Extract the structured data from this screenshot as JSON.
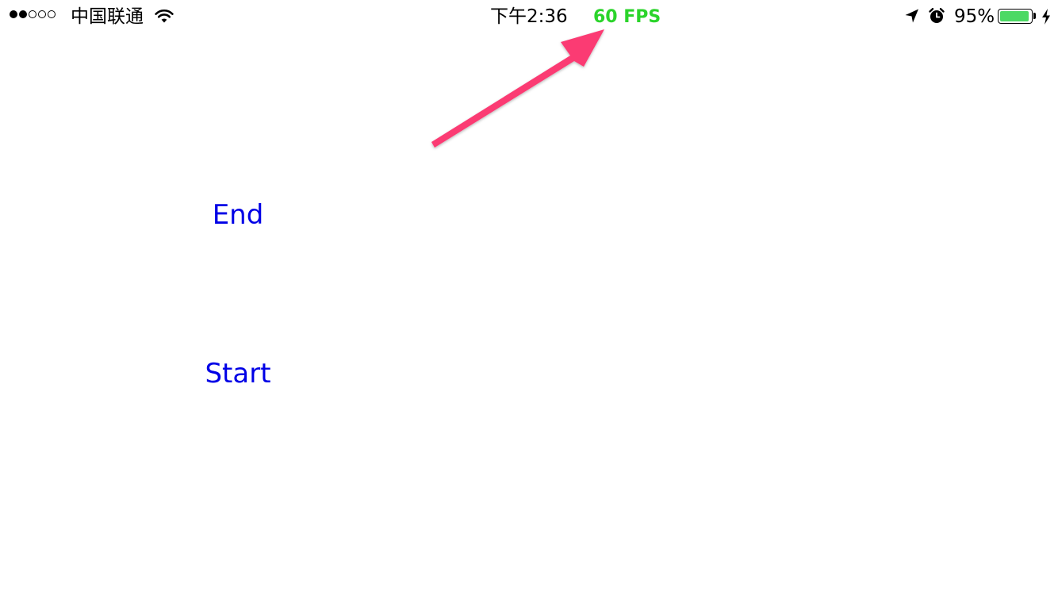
{
  "status_bar": {
    "signal": {
      "filled": 2,
      "total": 5
    },
    "carrier": "中国联通",
    "time": "下午2:36",
    "fps": "60 FPS",
    "battery_percent": "95%",
    "battery_level": 0.95,
    "icons": {
      "wifi": "wifi-icon",
      "location": "location-arrow-icon",
      "alarm": "alarm-clock-icon",
      "battery": "battery-icon",
      "charging": "charging-bolt-icon"
    }
  },
  "main": {
    "end_label": "End",
    "start_label": "Start"
  },
  "annotation": {
    "arrow_icon": "pointer-arrow-icon"
  },
  "colors": {
    "fps": "#2bd42b",
    "battery_fill": "#4cd964",
    "button_text": "#0000e6",
    "arrow": "#fb3a73"
  }
}
